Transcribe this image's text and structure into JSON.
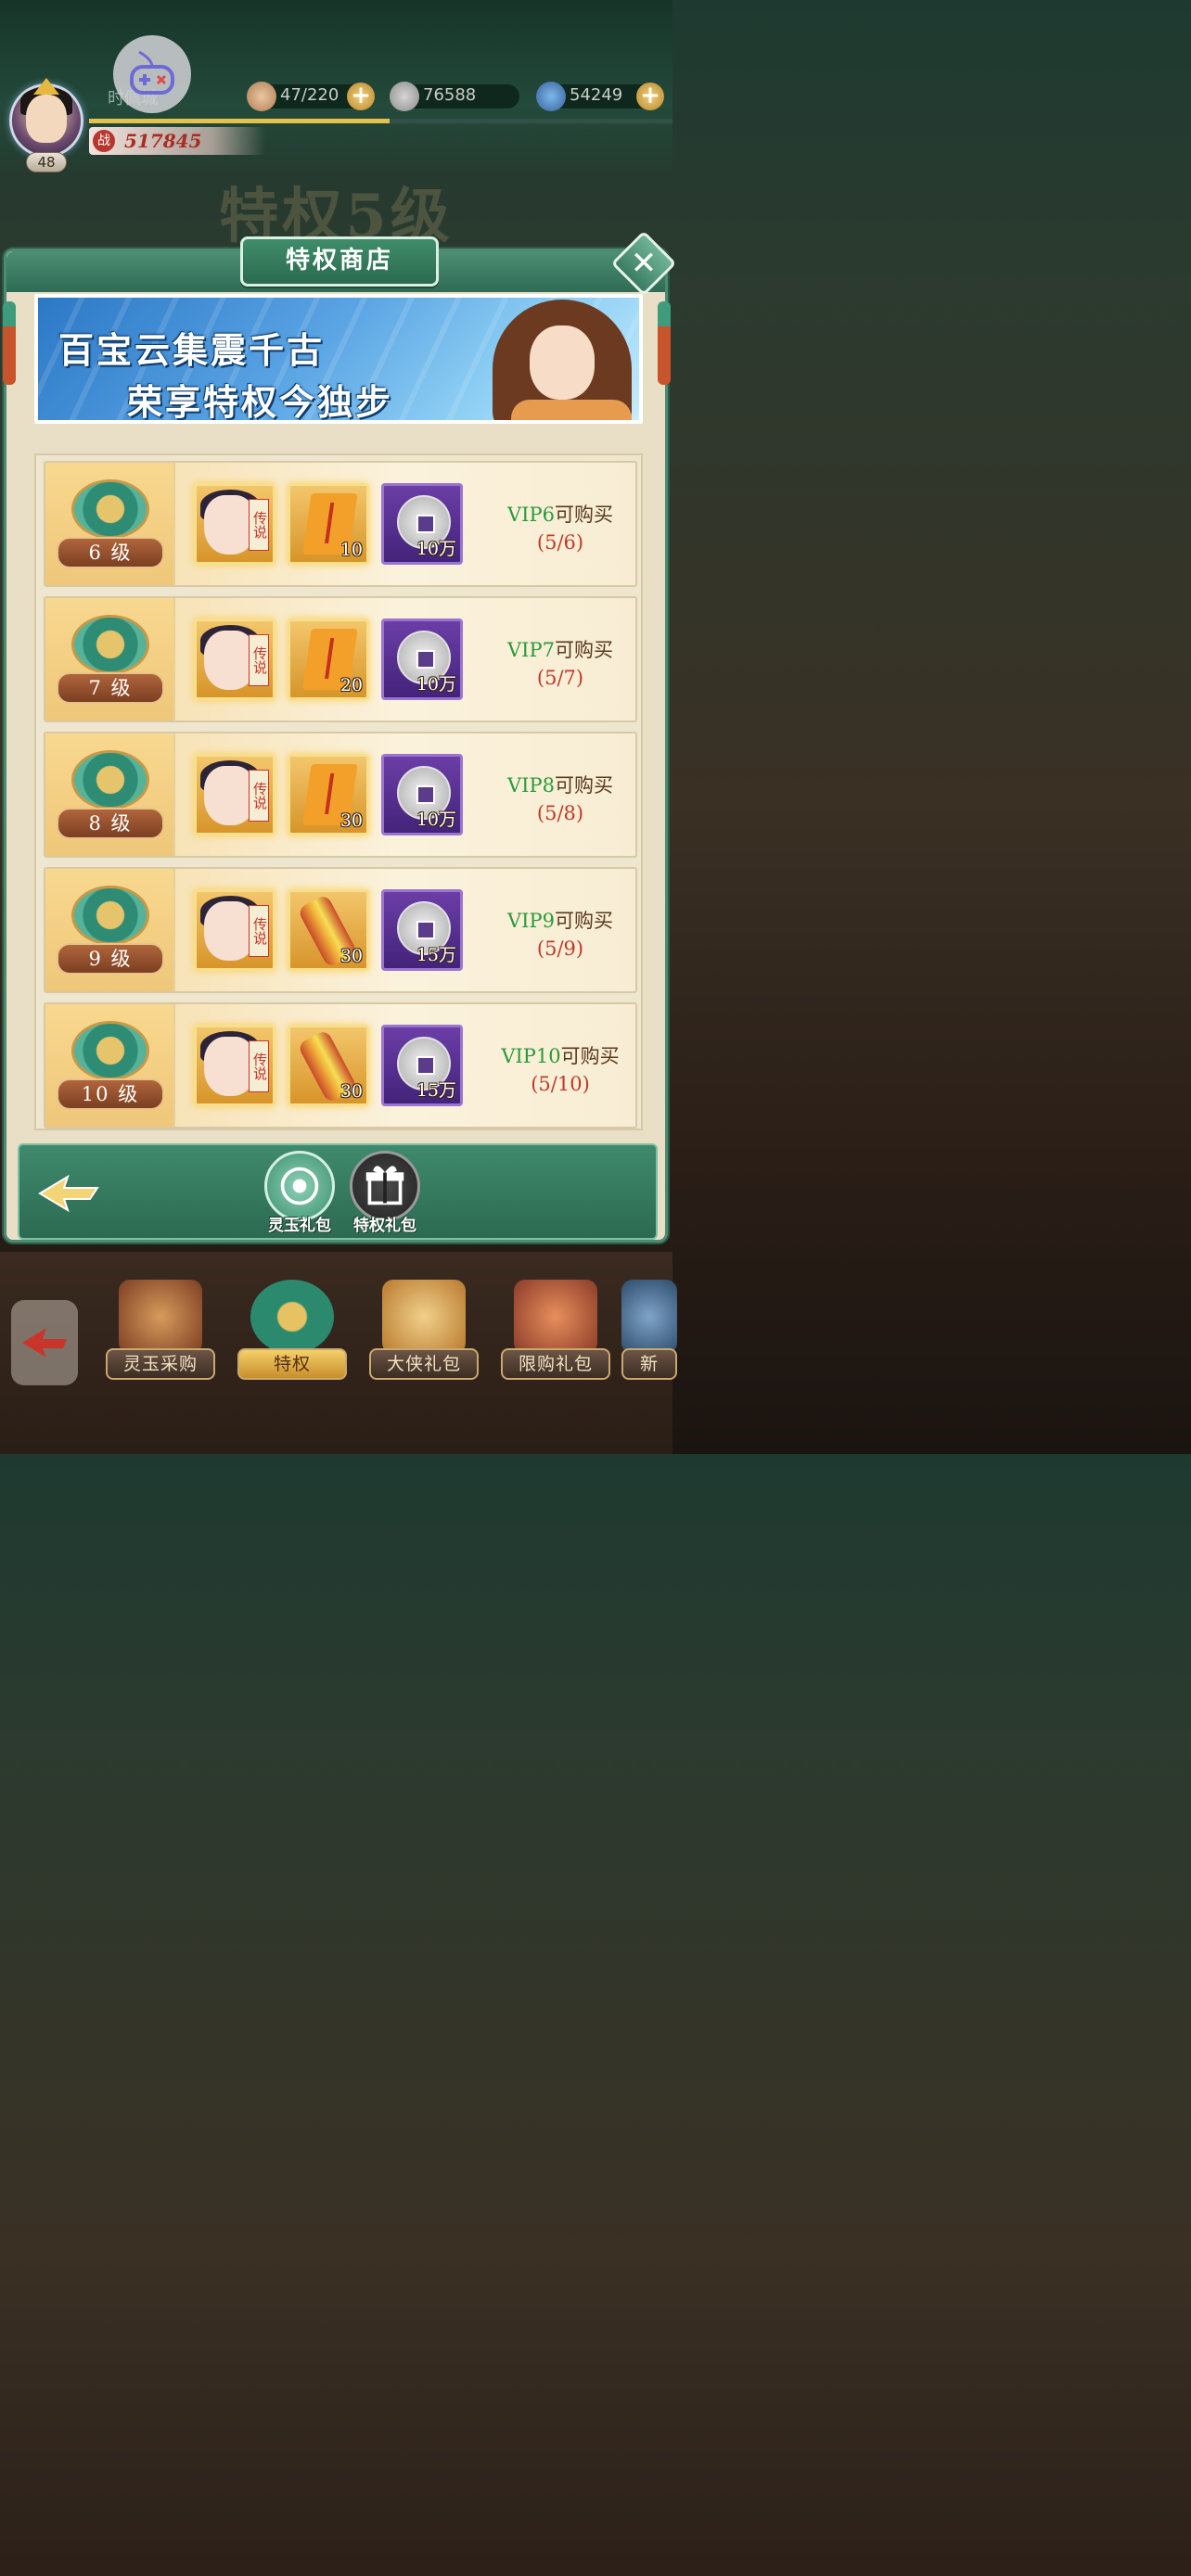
{
  "hud": {
    "player_name": "时佩城",
    "level": "48",
    "power_label": "战",
    "power": "517845",
    "resources": [
      {
        "icon": "stamina-bun-icon",
        "value": "47/220"
      },
      {
        "icon": "silver-coin-icon",
        "value": "76588"
      },
      {
        "icon": "jade-icon",
        "value": "54249"
      }
    ]
  },
  "background_title": "特权5级",
  "modal": {
    "title": "特权商店",
    "close_symbol": "✕",
    "banner": {
      "line1": "百宝云集震千古",
      "line2": "荣享特权今独步"
    },
    "hero_tag": "传说",
    "rows": [
      {
        "level": "6 级",
        "item2_count": "10",
        "item2_type": "scroll",
        "coin_count": "10万",
        "vip": "VIP6",
        "buy_text": "可购买",
        "progress": "(5/6)"
      },
      {
        "level": "7 级",
        "item2_count": "20",
        "item2_type": "scroll",
        "coin_count": "10万",
        "vip": "VIP7",
        "buy_text": "可购买",
        "progress": "(5/7)"
      },
      {
        "level": "8 级",
        "item2_count": "30",
        "item2_type": "scroll",
        "coin_count": "10万",
        "vip": "VIP8",
        "buy_text": "可购买",
        "progress": "(5/8)"
      },
      {
        "level": "9 级",
        "item2_count": "30",
        "item2_type": "tube",
        "coin_count": "15万",
        "vip": "VIP9",
        "buy_text": "可购买",
        "progress": "(5/9)"
      },
      {
        "level": "10 级",
        "item2_count": "30",
        "item2_type": "tube",
        "coin_count": "15万",
        "vip": "VIP10",
        "buy_text": "可购买",
        "progress": "(5/10)"
      }
    ],
    "footer_tabs": {
      "jade_pack": "灵玉礼包",
      "vip_pack": "特权礼包"
    }
  },
  "bottom_nav": [
    {
      "label": "灵玉采购"
    },
    {
      "label": "特权",
      "active": true
    },
    {
      "label": "大侠礼包"
    },
    {
      "label": "限购礼包"
    },
    {
      "label": "新"
    }
  ],
  "colors": {
    "accent_green": "#3f8a6d",
    "vip_green": "#2a9a3a",
    "progress_red": "#c0392b",
    "power_red": "#a72d22"
  }
}
